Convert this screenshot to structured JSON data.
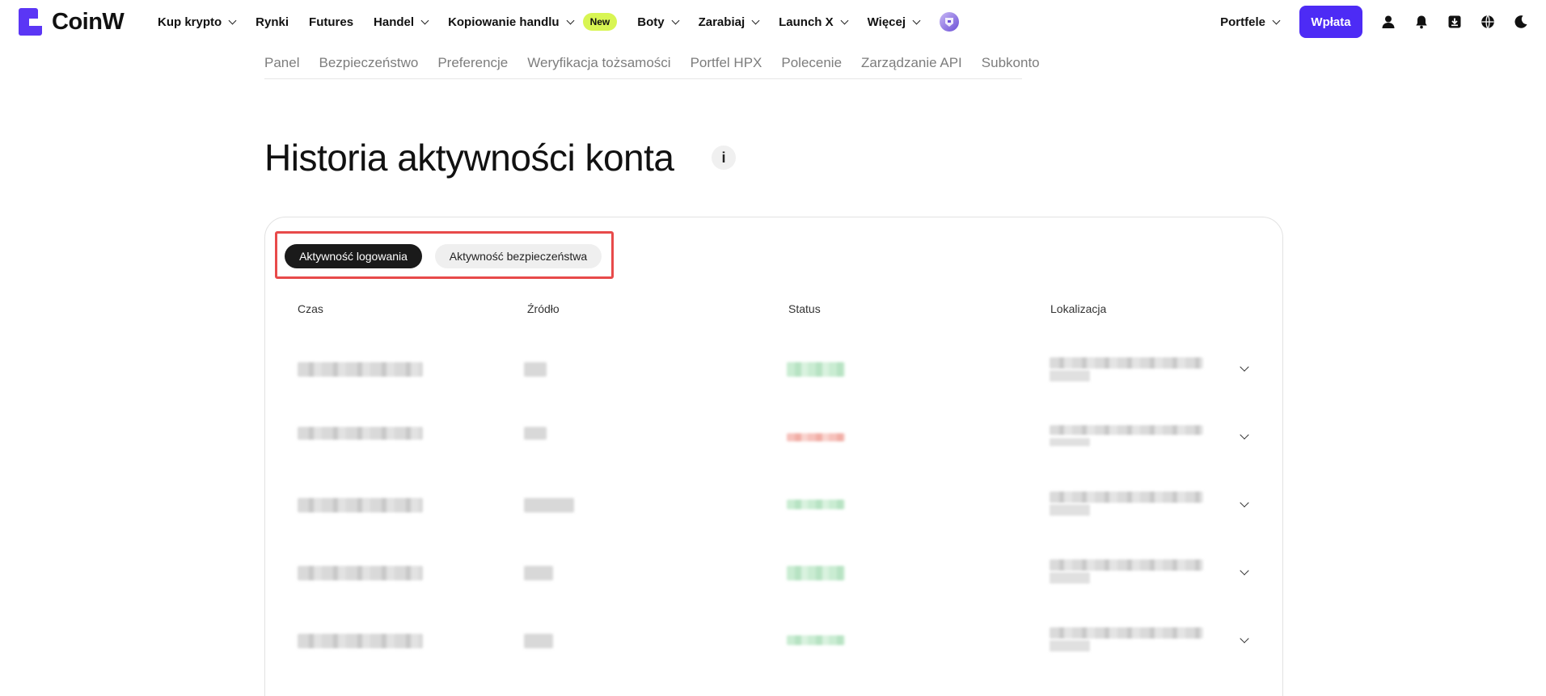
{
  "brand": {
    "name": "CoinW"
  },
  "nav": {
    "items": [
      {
        "label": "Kup krypto",
        "dropdown": true
      },
      {
        "label": "Rynki",
        "dropdown": false
      },
      {
        "label": "Futures",
        "dropdown": false
      },
      {
        "label": "Handel",
        "dropdown": true
      },
      {
        "label": "Kopiowanie handlu",
        "dropdown": true,
        "badge": "New"
      },
      {
        "label": "Boty",
        "dropdown": true
      },
      {
        "label": "Zarabiaj",
        "dropdown": true
      },
      {
        "label": "Launch X",
        "dropdown": true
      },
      {
        "label": "Więcej",
        "dropdown": true
      }
    ],
    "wallets_label": "Portfele",
    "deposit_label": "Wpłata",
    "icons": [
      "profile-icon",
      "bell-icon",
      "download-icon",
      "globe-icon",
      "moon-icon"
    ]
  },
  "subnav": {
    "items": [
      "Panel",
      "Bezpieczeństwo",
      "Preferencje",
      "Weryfikacja tożsamości",
      "Portfel HPX",
      "Polecenie",
      "Zarządzanie API",
      "Subkonto"
    ]
  },
  "page": {
    "title": "Historia aktywności konta",
    "info_label": "i"
  },
  "tabs": {
    "active": "Aktywność logowania",
    "inactive": "Aktywność bezpieczeństwa"
  },
  "table": {
    "headers": [
      "Czas",
      "Źródło",
      "Status",
      "Lokalizacja"
    ],
    "rows": [
      {
        "status": "success"
      },
      {
        "status": "failed"
      },
      {
        "status": "success"
      },
      {
        "status": "success"
      },
      {
        "status": "success"
      }
    ]
  },
  "colors": {
    "accent": "#4d2bf5",
    "badge_new": "#d8f553",
    "highlight_border": "#e84a4a",
    "success": "#b7e3c3",
    "failed": "#f1aea6"
  }
}
